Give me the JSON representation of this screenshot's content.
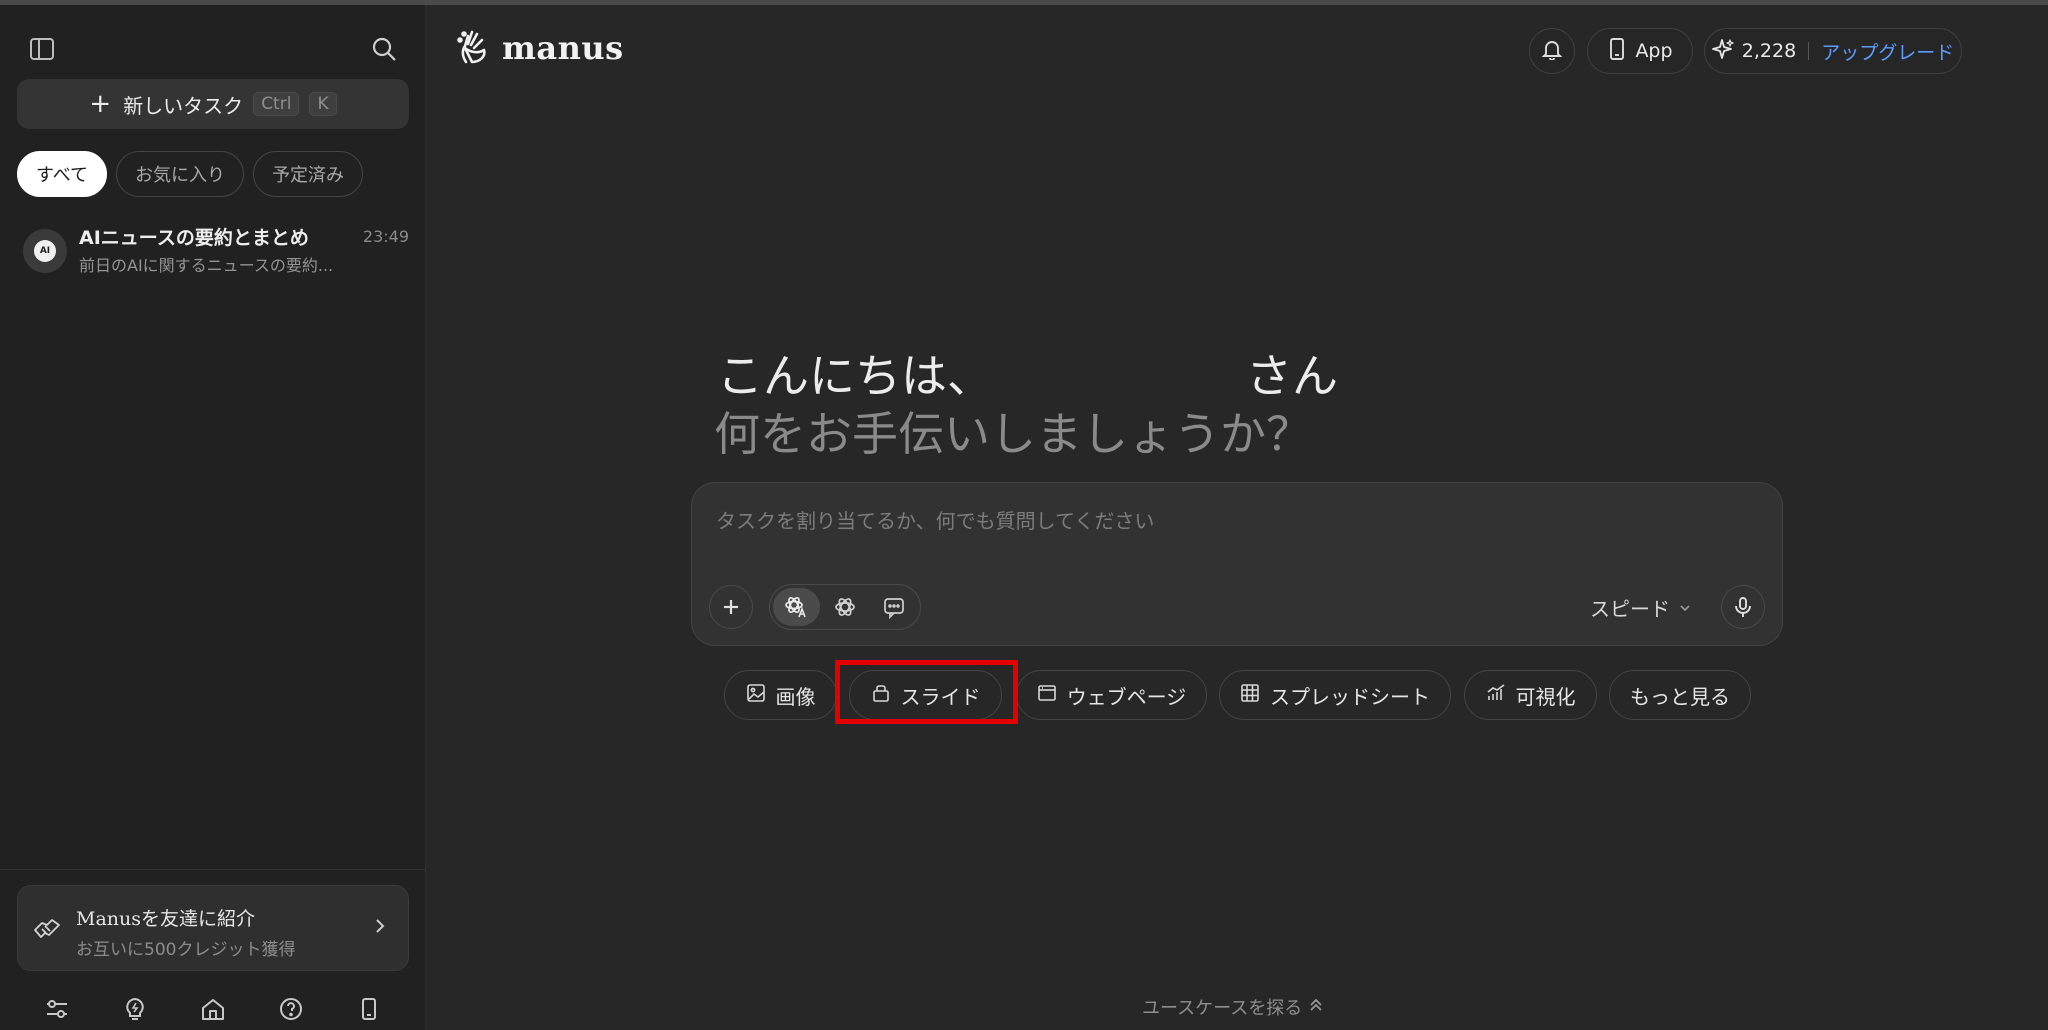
{
  "sidebar": {
    "new_task": {
      "label": "新しいタスク",
      "key1": "Ctrl",
      "key2": "K"
    },
    "filters": [
      "すべて",
      "お気に入り",
      "予定済み"
    ],
    "task": {
      "avatar_text": "AI",
      "title": "AIニュースの要約とまとめ",
      "time": "23:49",
      "subtitle": "前日のAIに関するニュースの要約..."
    },
    "referral": {
      "title": "Manusを友達に紹介",
      "subtitle": "お互いに500クレジット獲得"
    }
  },
  "header": {
    "logo": "manus",
    "app_label": "App",
    "credits": "2,228",
    "upgrade_label": "アップグレード"
  },
  "main": {
    "greeting_line1": "こんにちは、　　　　　　さん",
    "greeting_line2": "何をお手伝いしましょうか？",
    "input_placeholder": "タスクを割り当てるか、何でも質問してください",
    "speed_label": "スピード",
    "chips": [
      "画像",
      "スライド",
      "ウェブページ",
      "スプレッドシート",
      "可視化",
      "もっと見る"
    ],
    "explore_label": "ユースケースを探る"
  },
  "colors": {
    "background": "#272727",
    "sidebar": "#212121",
    "accent": "#5b9dff",
    "highlight": "#e40000"
  }
}
